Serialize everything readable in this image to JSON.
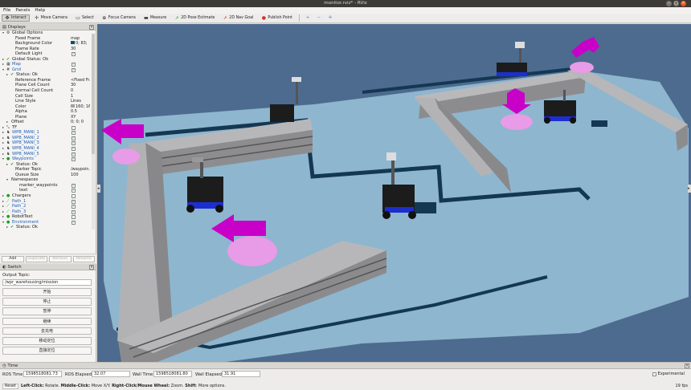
{
  "window": {
    "title": "monitor.rviz* - RViz"
  },
  "menu": [
    "File",
    "Panels",
    "Help"
  ],
  "toolbar": [
    {
      "label": "Interact",
      "icon": "interact-icon",
      "glyph": "✥",
      "active": true
    },
    {
      "label": "Move Camera",
      "icon": "move-camera-icon",
      "glyph": "✛"
    },
    {
      "label": "Select",
      "icon": "select-icon",
      "glyph": "▭"
    },
    {
      "label": "Focus Camera",
      "icon": "focus-camera-icon",
      "glyph": "⊕"
    },
    {
      "label": "Measure",
      "icon": "measure-icon",
      "glyph": "▬"
    },
    {
      "label": "2D Pose Estimate",
      "icon": "pose-estimate-arrow-icon",
      "glyph": "➚"
    },
    {
      "label": "2D Nav Goal",
      "icon": "nav-goal-arrow-icon",
      "glyph": "➚"
    },
    {
      "label": "Publish Point",
      "icon": "publish-point-icon",
      "glyph": "●"
    }
  ],
  "displays": {
    "title": "Displays",
    "rows": [
      {
        "label": "Global Options",
        "indent": 0,
        "arrow": "▾",
        "icon": "⚙",
        "value": ""
      },
      {
        "label": "Fixed Frame",
        "indent": 2,
        "value": "map"
      },
      {
        "label": "Background Color",
        "indent": 2,
        "value": "0; 83;",
        "swatch": "#00536b"
      },
      {
        "label": "Frame Rate",
        "indent": 2,
        "value": "30"
      },
      {
        "label": "Default Light",
        "indent": 2,
        "check": true
      },
      {
        "label": "Global Status: Ok",
        "indent": 0,
        "arrow": "▸",
        "icon": "✔",
        "iconColor": "#19a019"
      },
      {
        "label": "Map",
        "indent": 0,
        "arrow": "▸",
        "icon": "▦",
        "blue": true,
        "check": true
      },
      {
        "label": "Grid",
        "indent": 0,
        "arrow": "▾",
        "icon": "#",
        "blue": true,
        "check": true
      },
      {
        "label": "Status: Ok",
        "indent": 1,
        "arrow": "▸",
        "icon": "✔"
      },
      {
        "label": "Reference Frame",
        "indent": 2,
        "value": "<Fixed Fr..."
      },
      {
        "label": "Plane Cell Count",
        "indent": 2,
        "value": "30"
      },
      {
        "label": "Normal Cell Count",
        "indent": 2,
        "value": "0"
      },
      {
        "label": "Cell Size",
        "indent": 2,
        "value": "1"
      },
      {
        "label": "Line Style",
        "indent": 2,
        "value": "Lines"
      },
      {
        "label": "Color",
        "indent": 2,
        "value": "160; 16...",
        "swatch": "#a0a0a4"
      },
      {
        "label": "Alpha",
        "indent": 2,
        "value": "0.5"
      },
      {
        "label": "Plane",
        "indent": 2,
        "value": "XY"
      },
      {
        "label": "Offset",
        "indent": 1,
        "arrow": "▸",
        "value": "0; 0; 0"
      },
      {
        "label": "TF",
        "indent": 0,
        "arrow": "▸",
        "icon": "⤡",
        "check": false
      },
      {
        "label": "WPB_MANI_1",
        "indent": 0,
        "arrow": "▸",
        "icon": "♞",
        "blue": true,
        "check": true
      },
      {
        "label": "WPB_MANI_2",
        "indent": 0,
        "arrow": "▸",
        "icon": "♞",
        "blue": true,
        "check": true
      },
      {
        "label": "WPB_MANI_3",
        "indent": 0,
        "arrow": "▸",
        "icon": "♞",
        "blue": true,
        "check": true
      },
      {
        "label": "WPB_MANI_4",
        "indent": 0,
        "arrow": "▸",
        "icon": "♞",
        "blue": true,
        "check": true
      },
      {
        "label": "WPB_MANI_5",
        "indent": 0,
        "arrow": "▸",
        "icon": "♞",
        "blue": true,
        "check": true
      },
      {
        "label": "Waypoints",
        "indent": 0,
        "arrow": "▾",
        "icon": "●",
        "iconColor": "#19a019",
        "blue": true,
        "check": true
      },
      {
        "label": "Status: Ok",
        "indent": 1,
        "arrow": "▸",
        "icon": "✔"
      },
      {
        "label": "Marker Topic",
        "indent": 2,
        "value": "/waypoin..."
      },
      {
        "label": "Queue Size",
        "indent": 2,
        "value": "100"
      },
      {
        "label": "Namespaces",
        "indent": 1,
        "arrow": "▾"
      },
      {
        "label": "marker_waypoints",
        "indent": 3,
        "check": true
      },
      {
        "label": "text",
        "indent": 3,
        "check": true
      },
      {
        "label": "Chargers",
        "indent": 0,
        "arrow": "▸",
        "icon": "●",
        "iconColor": "#19a019",
        "check": false
      },
      {
        "label": "Path_1",
        "indent": 0,
        "arrow": "▸",
        "icon": "⟋",
        "iconColor": "#19a019",
        "blue": true,
        "check": true
      },
      {
        "label": "Path_2",
        "indent": 0,
        "arrow": "▸",
        "icon": "⟋",
        "iconColor": "#19a019",
        "blue": true,
        "check": true
      },
      {
        "label": "Path_3",
        "indent": 0,
        "arrow": "▸",
        "icon": "⟋",
        "iconColor": "#19a019",
        "blue": true,
        "check": true
      },
      {
        "label": "RobotText",
        "indent": 0,
        "arrow": "▸",
        "icon": "●",
        "iconColor": "#19a019",
        "check": false
      },
      {
        "label": "Environment",
        "indent": 0,
        "arrow": "▾",
        "icon": "●",
        "iconColor": "#19a019",
        "blue": true,
        "check": true
      },
      {
        "label": "Status: Ok",
        "indent": 1,
        "arrow": "▸",
        "icon": "✔"
      }
    ],
    "buttons": [
      {
        "label": "Add",
        "enabled": true
      },
      {
        "label": "Duplicate",
        "enabled": false
      },
      {
        "label": "Remove",
        "enabled": false
      },
      {
        "label": "Rename",
        "enabled": false
      }
    ]
  },
  "switch": {
    "title": "Switch",
    "output_label": "Output Topic:",
    "topic_value": "/wpr_warehousing/mission",
    "buttons": [
      "开始",
      "停止",
      "暂停",
      "继续",
      "去充电",
      "移动定位",
      "直接定位"
    ]
  },
  "time": {
    "title": "Time",
    "ros_time_label": "ROS Time:",
    "ros_time": "1598518081.73",
    "ros_elapsed_label": "ROS Elapsed:",
    "ros_elapsed": "32.07",
    "wall_time_label": "Wall Time:",
    "wall_time": "1598518081.80",
    "wall_elapsed_label": "Wall Elapsed:",
    "wall_elapsed": "31.91",
    "experimental": "Experimental"
  },
  "status": {
    "reset": "Reset",
    "hint_parts": [
      {
        "t": "Left-Click:",
        "b": true
      },
      {
        "t": " Rotate. ",
        "b": false
      },
      {
        "t": "Middle-Click:",
        "b": true
      },
      {
        "t": " Move X/Y. ",
        "b": false
      },
      {
        "t": "Right-Click/Mouse Wheel:",
        "b": true
      },
      {
        "t": " Zoom. ",
        "b": false
      },
      {
        "t": "Shift",
        "b": true
      },
      {
        "t": ": More options.",
        "b": false
      }
    ],
    "fps": "19 fps"
  },
  "colors": {
    "background": "#4d6b8e",
    "map_free": "#8eb6cf",
    "wall_dark": "#143752",
    "shelf": "#9f9fa1",
    "marker": "#c800c8",
    "robot": "#1c1c1c",
    "robot_base": "#1d2ed0"
  }
}
